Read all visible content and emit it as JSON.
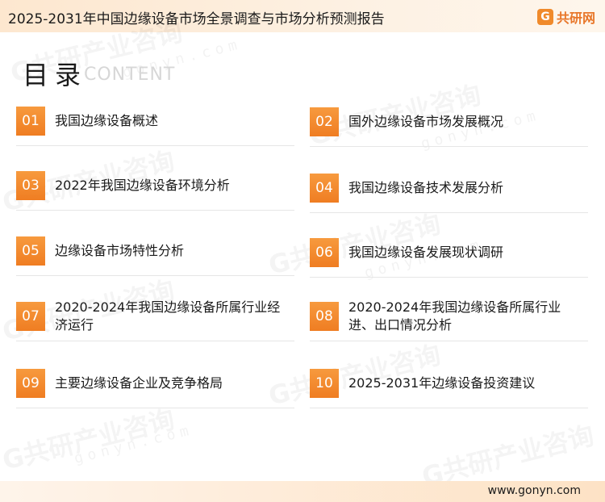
{
  "header": {
    "title": "2025-2031年中国边缘设备市场全景调查与市场分析预测报告",
    "brand_icon": "G",
    "brand_name": "共研网"
  },
  "toc": {
    "title": "目录",
    "subtitle": "CONTENT",
    "items": [
      {
        "num": "01",
        "label": "我国边缘设备概述"
      },
      {
        "num": "02",
        "label": "国外边缘设备市场发展概况"
      },
      {
        "num": "03",
        "label": "2022年我国边缘设备环境分析"
      },
      {
        "num": "04",
        "label": "我国边缘设备技术发展分析"
      },
      {
        "num": "05",
        "label": "边缘设备市场特性分析"
      },
      {
        "num": "06",
        "label": "我国边缘设备发展现状调研"
      },
      {
        "num": "07",
        "label": "2020-2024年我国边缘设备所属行业经济运行"
      },
      {
        "num": "08",
        "label": "2020-2024年我国边缘设备所属行业进、出口情况分析"
      },
      {
        "num": "09",
        "label": "主要边缘设备企业及竞争格局"
      },
      {
        "num": "10",
        "label": "2025-2031年边缘设备投资建议"
      }
    ]
  },
  "watermark": {
    "text": "G共研产业咨询",
    "url_text": "gonyn.com"
  },
  "footer": {
    "url": "www.gonyn.com"
  },
  "colors": {
    "accent": "#ef7d22",
    "header_bg": "#fde7cf"
  }
}
